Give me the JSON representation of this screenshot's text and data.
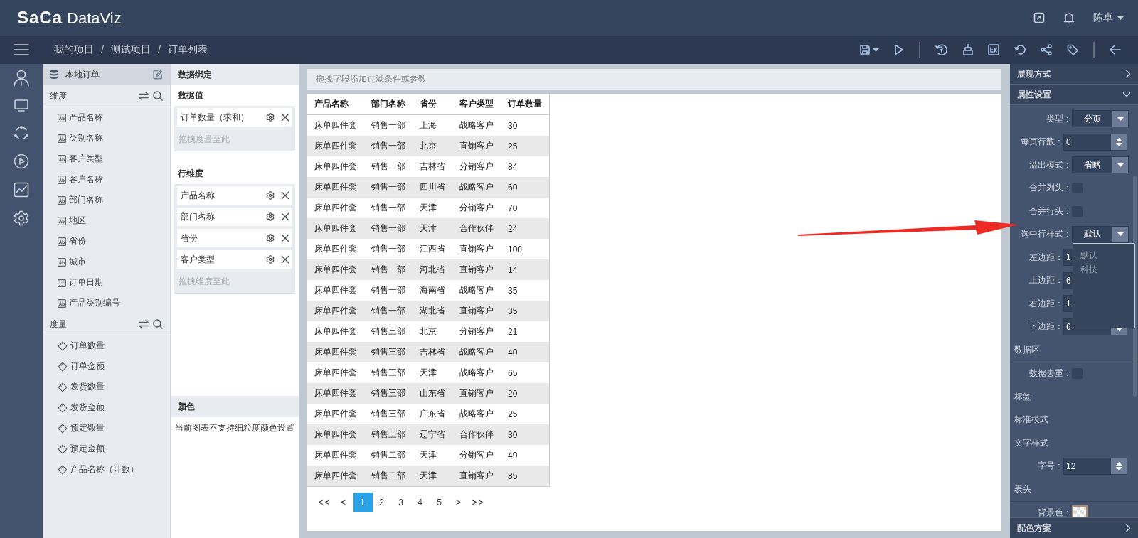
{
  "top_bar": {
    "logo_brand": "SaCa",
    "logo_product": "DataViz",
    "user": "陈卓"
  },
  "breadcrumb": {
    "separator": "/",
    "items": [
      "我的项目",
      "测试项目",
      "订单列表"
    ]
  },
  "fields_panel": {
    "title": "本地订单",
    "groups": [
      {
        "title": "维度",
        "items": [
          {
            "label": "产品名称",
            "kind": "text"
          },
          {
            "label": "类别名称",
            "kind": "text"
          },
          {
            "label": "客户类型",
            "kind": "text"
          },
          {
            "label": "客户名称",
            "kind": "text"
          },
          {
            "label": "部门名称",
            "kind": "text"
          },
          {
            "label": "地区",
            "kind": "text"
          },
          {
            "label": "省份",
            "kind": "text"
          },
          {
            "label": "城市",
            "kind": "text"
          },
          {
            "label": "订单日期",
            "kind": "date"
          },
          {
            "label": "产品类别编号",
            "kind": "text"
          }
        ]
      },
      {
        "title": "度量",
        "items": [
          {
            "label": "订单数量",
            "kind": "measure"
          },
          {
            "label": "订单金额",
            "kind": "measure"
          },
          {
            "label": "发货数量",
            "kind": "measure"
          },
          {
            "label": "发货金额",
            "kind": "measure"
          },
          {
            "label": "预定数量",
            "kind": "measure"
          },
          {
            "label": "预定金额",
            "kind": "measure"
          },
          {
            "label": "产品名称（计数）",
            "kind": "measure"
          }
        ]
      }
    ]
  },
  "binding_panel": {
    "title": "数据绑定",
    "sections": [
      {
        "title": "数据值",
        "pills": [
          "订单数量（求和）"
        ],
        "hint": "拖拽度量至此"
      },
      {
        "title": "行维度",
        "pills": [
          "产品名称",
          "部门名称",
          "省份",
          "客户类型"
        ],
        "hint": "拖拽维度至此"
      }
    ],
    "color": {
      "title": "颜色",
      "note": "当前图表不支持细粒度颜色设置"
    }
  },
  "canvas": {
    "filter_placeholder": "拖拽字段添加过滤条件或参数",
    "table": {
      "columns": [
        "产品名称",
        "部门名称",
        "省份",
        "客户类型",
        "订单数量"
      ],
      "rows": [
        [
          "床单四件套",
          "销售一部",
          "上海",
          "战略客户",
          "30"
        ],
        [
          "床单四件套",
          "销售一部",
          "北京",
          "直销客户",
          "25"
        ],
        [
          "床单四件套",
          "销售一部",
          "吉林省",
          "分销客户",
          "84"
        ],
        [
          "床单四件套",
          "销售一部",
          "四川省",
          "战略客户",
          "60"
        ],
        [
          "床单四件套",
          "销售一部",
          "天津",
          "分销客户",
          "70"
        ],
        [
          "床单四件套",
          "销售一部",
          "天津",
          "合作伙伴",
          "24"
        ],
        [
          "床单四件套",
          "销售一部",
          "江西省",
          "直销客户",
          "100"
        ],
        [
          "床单四件套",
          "销售一部",
          "河北省",
          "直销客户",
          "14"
        ],
        [
          "床单四件套",
          "销售一部",
          "海南省",
          "战略客户",
          "35"
        ],
        [
          "床单四件套",
          "销售一部",
          "湖北省",
          "直销客户",
          "35"
        ],
        [
          "床单四件套",
          "销售三部",
          "北京",
          "分销客户",
          "21"
        ],
        [
          "床单四件套",
          "销售三部",
          "吉林省",
          "战略客户",
          "40"
        ],
        [
          "床单四件套",
          "销售三部",
          "天津",
          "战略客户",
          "65"
        ],
        [
          "床单四件套",
          "销售三部",
          "山东省",
          "直销客户",
          "20"
        ],
        [
          "床单四件套",
          "销售三部",
          "广东省",
          "战略客户",
          "25"
        ],
        [
          "床单四件套",
          "销售三部",
          "辽宁省",
          "合作伙伴",
          "30"
        ],
        [
          "床单四件套",
          "销售二部",
          "天津",
          "分销客户",
          "49"
        ],
        [
          "床单四件套",
          "销售二部",
          "天津",
          "直销客户",
          "85"
        ]
      ]
    },
    "pagination": [
      {
        "label": "<<",
        "selected": false
      },
      {
        "label": "<",
        "selected": false
      },
      {
        "label": "1",
        "selected": true
      },
      {
        "label": "2",
        "selected": false
      },
      {
        "label": "3",
        "selected": false
      },
      {
        "label": "4",
        "selected": false
      },
      {
        "label": "5",
        "selected": false
      },
      {
        "label": ">",
        "selected": false
      },
      {
        "label": ">>",
        "selected": false
      }
    ]
  },
  "properties_panel": {
    "sections": [
      {
        "title": "展现方式",
        "expanded": false
      },
      {
        "title": "属性设置",
        "expanded": true
      }
    ],
    "properties": [
      {
        "kind": "select",
        "label": "类型：",
        "value": "分页",
        "open": false
      },
      {
        "kind": "spinner",
        "label": "每页行数：",
        "value": "0"
      },
      {
        "kind": "select",
        "label": "溢出模式：",
        "value": "省略",
        "open": false
      },
      {
        "kind": "checkbox",
        "label": "合并列头：",
        "checked": false
      },
      {
        "kind": "checkbox",
        "label": "合并行头：",
        "checked": false
      },
      {
        "kind": "select",
        "label": "选中行样式：",
        "value": "默认",
        "open": true,
        "options": [
          "默认",
          "科技"
        ]
      },
      {
        "kind": "spinner",
        "label": "左边距：",
        "value": "1"
      },
      {
        "kind": "spinner",
        "label": "上边距：",
        "value": "6"
      },
      {
        "kind": "spinner",
        "label": "右边距：",
        "value": "1"
      },
      {
        "kind": "spinner",
        "label": "下边距：",
        "value": "6"
      },
      {
        "kind": "group",
        "label": "数据区"
      },
      {
        "kind": "checkbox",
        "label": "数据去重：",
        "checked": false
      },
      {
        "kind": "heading",
        "label": "标签"
      },
      {
        "kind": "heading",
        "label": "标准模式"
      },
      {
        "kind": "heading",
        "label": "文字样式"
      },
      {
        "kind": "spinner",
        "label": "字号：",
        "value": "12"
      },
      {
        "kind": "group",
        "label": "表头"
      },
      {
        "kind": "color",
        "label": "背景色："
      }
    ],
    "footer": {
      "title": "配色方案"
    }
  }
}
